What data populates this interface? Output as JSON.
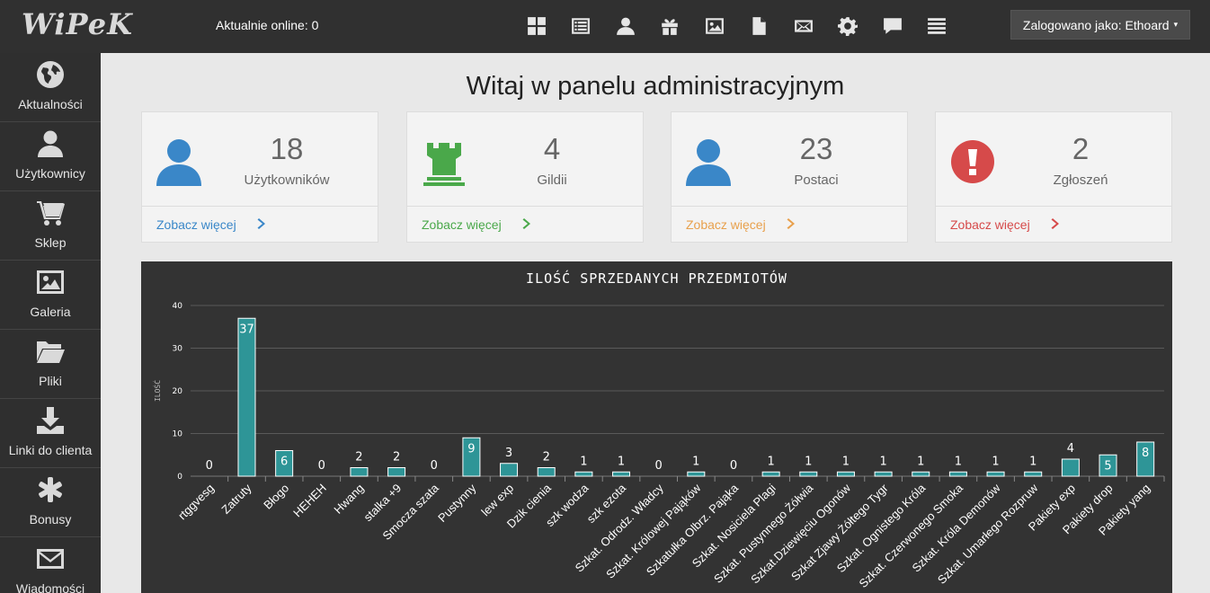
{
  "header": {
    "logo": "WiPeK",
    "online_text": "Aktualnie online: 0",
    "icons": [
      "dashboard-icon",
      "list-icon",
      "user-icon",
      "gift-icon",
      "image-icon",
      "file-icon",
      "mail-icon",
      "gear-icon",
      "comment-icon",
      "menu-icon"
    ],
    "login_label": "Zalogowano jako: Ethoard",
    "login_caret": "▾"
  },
  "sidebar": {
    "items": [
      {
        "label": "Aktualności",
        "icon": "globe-icon"
      },
      {
        "label": "Użytkownicy",
        "icon": "user-icon"
      },
      {
        "label": "Sklep",
        "icon": "cart-icon"
      },
      {
        "label": "Galeria",
        "icon": "image-icon"
      },
      {
        "label": "Pliki",
        "icon": "folder-icon"
      },
      {
        "label": "Linki do clienta",
        "icon": "download-icon"
      },
      {
        "label": "Bonusy",
        "icon": "asterisk-icon"
      },
      {
        "label": "Wiadomości",
        "icon": "mail-icon"
      }
    ]
  },
  "page": {
    "title": "Witaj w panelu administracyjnym"
  },
  "cards": [
    {
      "value": "18",
      "label": "Użytkowników",
      "more": "Zobacz więcej",
      "color": "#3a87c8",
      "icon": "user-icon"
    },
    {
      "value": "4",
      "label": "Gildii",
      "more": "Zobacz więcej",
      "color": "#4aa84a",
      "icon": "castle-icon"
    },
    {
      "value": "23",
      "label": "Postaci",
      "more": "Zobacz więcej",
      "color": "#e8a04c",
      "icon": "user-icon"
    },
    {
      "value": "2",
      "label": "Zgłoszeń",
      "more": "Zobacz więcej",
      "color": "#d64a4a",
      "icon": "alert-icon"
    }
  ],
  "chart_data": {
    "type": "bar",
    "title": "ILOŚĆ SPRZEDANYCH PRZEDMIOTÓW",
    "ylabel": "ILOŚĆ",
    "xlabel": "",
    "ylim": [
      0,
      40
    ],
    "yticks": [
      0,
      10,
      20,
      30,
      40
    ],
    "grid": true,
    "bar_color": "#2e9597",
    "categories": [
      "rtggvesg",
      "Zatruty",
      "Błogo",
      "HEHEH",
      "Hwang",
      "stalka +9",
      "Smocza szata",
      "Pustynny",
      "lew exp",
      "Dzik cienia",
      "szk wodza",
      "szk ezota",
      "Szkat. Odrodz. Władcy",
      "Szkat. Królowej Pająków",
      "Szkatułka Olbrz. Pająka",
      "Szkat. Nosiciela Plagi",
      "Szkat. Pustynnego Żółwia",
      "Szkat.Dziewięciu Ogonów",
      "Szkat Zjawy Żółtego Tygr",
      "Szkat. Ognistego Króla",
      "Szkat. Czerwonego Smoka",
      "Szkat. Króla Demonów",
      "Szkat. Umarłego Rozpruw",
      "Pakiety exp",
      "Pakiety drop",
      "Pakiety yang"
    ],
    "values": [
      0,
      37,
      6,
      0,
      2,
      2,
      0,
      9,
      3,
      2,
      1,
      1,
      0,
      1,
      0,
      1,
      1,
      1,
      1,
      1,
      1,
      1,
      1,
      4,
      5,
      8
    ]
  }
}
